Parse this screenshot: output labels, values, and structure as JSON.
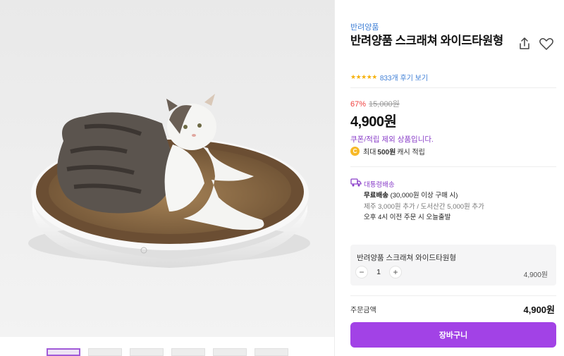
{
  "product": {
    "brand": "반려양품",
    "title": "반려양품 스크래쳐 와이드타원형",
    "rating": {
      "stars": "★★★★★",
      "review_link": "833개 후기 보기"
    },
    "pricing": {
      "discount_rate": "67%",
      "original_price": "15,000원",
      "sale_price": "4,900원"
    },
    "coupon_note": "쿠폰/적립 제외 상품입니다.",
    "cash": {
      "icon": "C",
      "prefix": "최대",
      "amount": "500원",
      "suffix": "캐시 적립"
    },
    "shipping": {
      "type": "대통령배송",
      "free_label": "무료배송",
      "free_condition": "(30,000원 이상 구매 시)",
      "extra_fee": "제주 3,000원 추가 / 도서산간 5,000원 추가",
      "today_notice": "오후 4시 이전 주문 시 오늘출발"
    },
    "option": {
      "name": "반려양품 스크래쳐 와이드타원형",
      "minus": "−",
      "quantity": "1",
      "plus": "+",
      "price": "4,900원"
    },
    "order_total": {
      "label": "주문금액",
      "value": "4,900원"
    },
    "cart_button": "장바구니"
  },
  "icons": {
    "share": "share-icon",
    "wishlist": "heart-icon",
    "shipping": "truck-icon",
    "cash": "cash-coin-icon"
  },
  "colors": {
    "accent": "#a242e6",
    "discount": "#f0413f",
    "link": "#3f7fd6",
    "star": "#f6b20f"
  }
}
